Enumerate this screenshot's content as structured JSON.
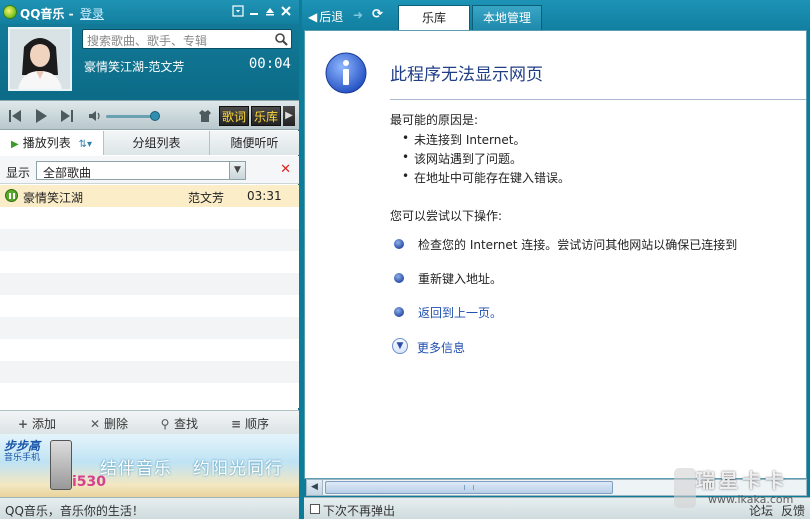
{
  "player": {
    "title": "QQ音乐",
    "title_sep": "-",
    "login": "登录",
    "search_placeholder": "搜索歌曲、歌手、专辑",
    "now_playing": "豪情笑江湖-范文芳",
    "time": "00:04",
    "lyrics_btn": "歌词",
    "library_btn": "乐库",
    "volume_level": 0.85,
    "tabs": [
      "播放列表",
      "分组列表",
      "随便听听"
    ],
    "filter_label": "显示",
    "filter_value": "全部歌曲",
    "songs": [
      {
        "title": "豪情笑江湖",
        "artist": "范文芳",
        "duration": "03:31"
      }
    ],
    "actions": [
      {
        "icon": "plus-icon",
        "label": "添加"
      },
      {
        "icon": "x-icon",
        "label": "删除"
      },
      {
        "icon": "search-icon",
        "label": "查找"
      },
      {
        "icon": "list-icon",
        "label": "顺序"
      }
    ],
    "ad": {
      "brand": "步步高",
      "sub": "音乐手机",
      "model": "i530",
      "slogan1": "结伴音乐",
      "slogan2": "约阳光同行"
    },
    "status": "QQ音乐，音乐你的生活！"
  },
  "browser": {
    "back": "后退",
    "tabs": [
      "乐库",
      "本地管理"
    ],
    "active_tab": "乐库",
    "error_title": "此程序无法显示网页",
    "causes_title": "最可能的原因是:",
    "causes": [
      "未连接到 Internet。",
      "该网站遇到了问题。",
      "在地址中可能存在键入错误。"
    ],
    "try_title": "您可以尝试以下操作:",
    "options": [
      "检查您的 Internet 连接。尝试访问其他网站以确保已连接到",
      "重新键入地址。",
      "返回到上一页。"
    ],
    "more_info": "更多信息",
    "no_popup": "下次不再弹出",
    "forum": "论坛",
    "feedback": "反馈"
  },
  "watermark": {
    "title": "瑞星卡卡",
    "url": "www.ikaka.com"
  },
  "colors": {
    "frame": "#0d7c98",
    "titlebar": "#1f93b5",
    "highlight_row": "#fbedc8",
    "link": "#1f4fb0",
    "error_title": "#1f3e86",
    "lyrics_text": "#ffd93a"
  }
}
